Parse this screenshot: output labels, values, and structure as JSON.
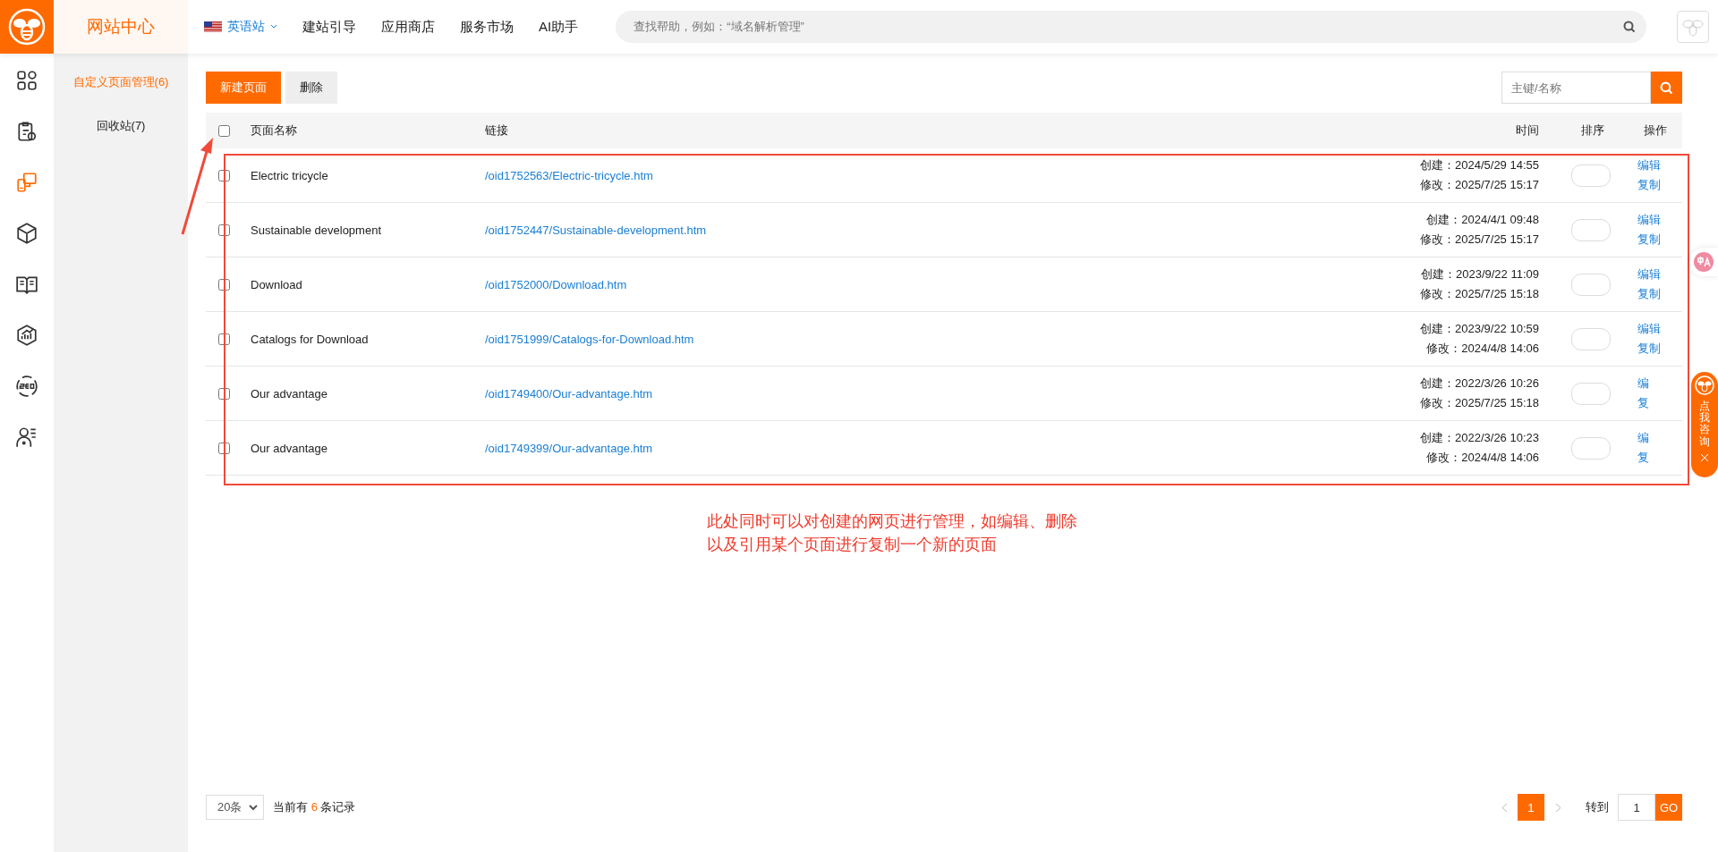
{
  "app": {
    "section_title": "网站中心"
  },
  "top_nav": {
    "site_selector": "英语站",
    "links": [
      "建站引导",
      "应用商店",
      "服务市场",
      "AI助手"
    ],
    "search": {
      "placeholder": "查找帮助，例如：“域名解析管理”"
    }
  },
  "rail": [
    {
      "selected": false
    },
    {
      "selected": false
    },
    {
      "selected": true
    },
    {
      "selected": false
    },
    {
      "selected": false
    },
    {
      "selected": false
    },
    {
      "selected": false
    },
    {
      "selected": false
    }
  ],
  "sidebar": {
    "items": [
      {
        "label": "自定义页面管理(6)",
        "selected": true
      },
      {
        "label": "回收站(7)",
        "selected": false
      }
    ]
  },
  "toolbar": {
    "buttons": [
      "新建页面",
      "删除"
    ],
    "search": {
      "placeholder": "主键/名称"
    }
  },
  "table": {
    "select_all": {
      "checked": false
    },
    "columns": [
      "页面名称",
      "链接",
      "时间",
      "排序",
      "操作"
    ],
    "rows": [
      {
        "checked": false,
        "name": "Electric tricycle",
        "link": "/oid1752563/Electric-tricycle.htm",
        "created": "创建：2024/5/29 14:55",
        "modified": "修改：2025/7/25 15:17",
        "actions": [
          "编辑",
          "复制"
        ]
      },
      {
        "checked": false,
        "name": "Sustainable development",
        "link": "/oid1752447/Sustainable-development.htm",
        "created": "创建：2024/4/1 09:48",
        "modified": "修改：2025/7/25 15:17",
        "actions": [
          "编辑",
          "复制"
        ]
      },
      {
        "checked": false,
        "name": "Download",
        "link": "/oid1752000/Download.htm",
        "created": "创建：2023/9/22 11:09",
        "modified": "修改：2025/7/25 15:18",
        "actions": [
          "编辑",
          "复制"
        ]
      },
      {
        "checked": false,
        "name": "Catalogs for Download",
        "link": "/oid1751999/Catalogs-for-Download.htm",
        "created": "创建：2023/9/22 10:59",
        "modified": "修改：2024/4/8 14:06",
        "actions": [
          "编辑",
          "复制"
        ]
      },
      {
        "checked": false,
        "name": "Our advantage",
        "link": "/oid1749400/Our-advantage.htm",
        "created": "创建：2022/3/26 10:26",
        "modified": "修改：2025/7/25 15:18",
        "actions": [
          "编",
          "复"
        ]
      },
      {
        "checked": false,
        "name": "Our advantage",
        "link": "/oid1749399/Our-advantage.htm",
        "created": "创建：2022/3/26 10:23",
        "modified": "修改：2024/4/8 14:06",
        "actions": [
          "编",
          "复"
        ]
      }
    ]
  },
  "annotation": {
    "lines": [
      "此处同时可以对创建的网页进行管理，如编辑、删除",
      "以及引用某个页面进行复制一个新的页面"
    ]
  },
  "pagination": {
    "page_size": "20条",
    "summary_before": "当前有",
    "count": "6",
    "summary_after": "条记录",
    "pages": [
      {
        "label": "1",
        "selected": true
      }
    ],
    "goto_label": "转到",
    "goto_value": "1",
    "go": "GO"
  },
  "floating": {
    "consult": "点我咨询"
  }
}
